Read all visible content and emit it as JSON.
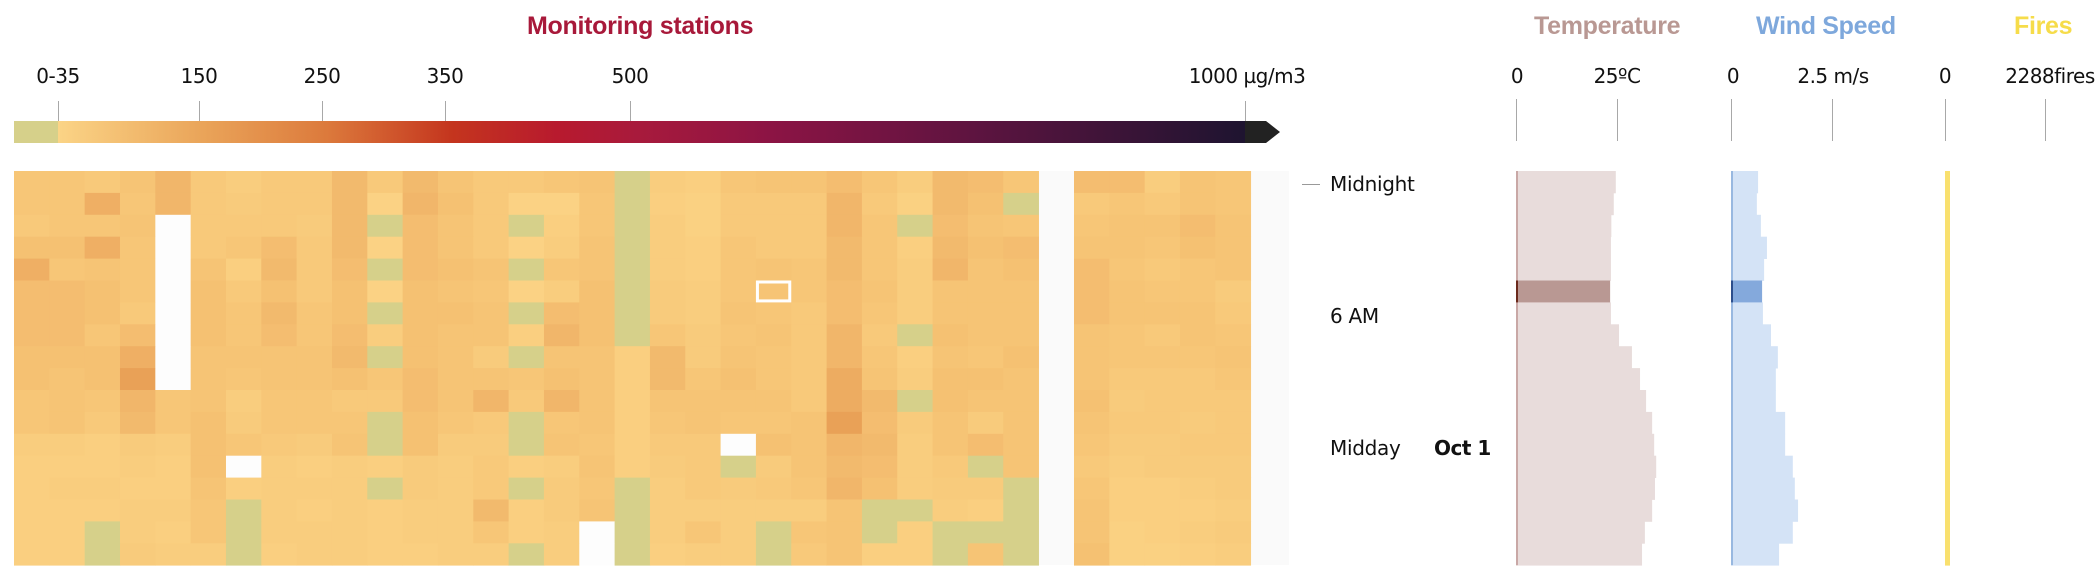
{
  "chart_data": {
    "type": "heatmap",
    "title": "Monitoring stations",
    "colorbar": {
      "unit": "µg/m3",
      "tick_labels": [
        "0-35",
        "150",
        "250",
        "350",
        "500",
        "1000 µg/m3"
      ],
      "tick_values": [
        35,
        150,
        250,
        350,
        500,
        1000
      ],
      "range": [
        0,
        1000
      ],
      "stops": [
        {
          "value": 0,
          "color": "#d6d08a"
        },
        {
          "value": 35,
          "color": "#d6d08a"
        },
        {
          "value": 35.01,
          "color": "#fbd486"
        },
        {
          "value": 150,
          "color": "#eaa55a"
        },
        {
          "value": 250,
          "color": "#dc7a3c"
        },
        {
          "value": 350,
          "color": "#c4351e"
        },
        {
          "value": 430,
          "color": "#b81a2e"
        },
        {
          "value": 500,
          "color": "#a81a3c"
        },
        {
          "value": 600,
          "color": "#8c1444"
        },
        {
          "value": 750,
          "color": "#5e1440"
        },
        {
          "value": 1000,
          "color": "#1e1430"
        },
        {
          "value": 1001,
          "color": "#222222"
        }
      ]
    },
    "y_labels": [
      {
        "label": "Midnight",
        "row": 0
      },
      {
        "label": "6 AM",
        "row": 6
      },
      {
        "label": "Midday",
        "row": 12
      }
    ],
    "date_label": {
      "label": "Oct 1",
      "row": 12
    },
    "hours": 18,
    "highlight": {
      "panel": 0,
      "row": 5,
      "col": 21
    },
    "panels": [
      {
        "name": "main",
        "columns": 29,
        "values": [
          [
            75,
            75,
            70,
            80,
            100,
            70,
            60,
            70,
            70,
            95,
            70,
            95,
            80,
            70,
            70,
            75,
            80,
            30,
            60,
            55,
            75,
            80,
            80,
            90,
            75,
            60,
            95,
            90,
            75
          ],
          [
            75,
            75,
            110,
            75,
            100,
            70,
            65,
            70,
            70,
            95,
            45,
            100,
            85,
            70,
            45,
            45,
            75,
            30,
            55,
            50,
            70,
            70,
            70,
            100,
            70,
            50,
            95,
            85,
            30
          ],
          [
            70,
            75,
            75,
            80,
            null,
            70,
            70,
            70,
            65,
            95,
            30,
            90,
            80,
            70,
            30,
            55,
            75,
            30,
            60,
            50,
            70,
            70,
            70,
            100,
            75,
            30,
            90,
            80,
            75
          ],
          [
            85,
            85,
            110,
            75,
            null,
            70,
            75,
            90,
            70,
            95,
            45,
            90,
            80,
            70,
            45,
            60,
            80,
            30,
            60,
            55,
            75,
            70,
            70,
            95,
            75,
            55,
            95,
            85,
            90
          ],
          [
            110,
            75,
            80,
            75,
            null,
            80,
            55,
            95,
            70,
            90,
            30,
            90,
            85,
            80,
            30,
            75,
            80,
            30,
            60,
            55,
            75,
            80,
            75,
            95,
            75,
            60,
            100,
            80,
            85
          ],
          [
            90,
            90,
            85,
            75,
            null,
            85,
            70,
            85,
            70,
            85,
            45,
            85,
            80,
            75,
            45,
            60,
            85,
            30,
            65,
            60,
            75,
            80,
            75,
            90,
            80,
            60,
            80,
            80,
            80
          ],
          [
            90,
            90,
            85,
            70,
            null,
            85,
            75,
            95,
            75,
            85,
            30,
            85,
            85,
            80,
            30,
            90,
            85,
            30,
            65,
            60,
            80,
            75,
            70,
            90,
            75,
            60,
            80,
            80,
            80
          ],
          [
            90,
            90,
            75,
            90,
            null,
            85,
            75,
            90,
            75,
            90,
            60,
            85,
            80,
            80,
            55,
            100,
            85,
            30,
            75,
            65,
            75,
            80,
            70,
            100,
            70,
            30,
            85,
            80,
            80
          ],
          [
            85,
            85,
            85,
            110,
            null,
            80,
            80,
            80,
            80,
            95,
            30,
            85,
            80,
            65,
            30,
            80,
            80,
            55,
            95,
            65,
            80,
            75,
            70,
            100,
            75,
            55,
            80,
            75,
            85
          ],
          [
            85,
            80,
            85,
            130,
            null,
            80,
            75,
            80,
            80,
            85,
            75,
            90,
            80,
            80,
            75,
            85,
            80,
            55,
            95,
            75,
            85,
            75,
            70,
            115,
            80,
            60,
            85,
            85,
            80
          ],
          [
            75,
            80,
            75,
            100,
            75,
            80,
            60,
            75,
            75,
            70,
            70,
            90,
            80,
            100,
            70,
            100,
            80,
            55,
            80,
            80,
            80,
            80,
            70,
            115,
            95,
            30,
            85,
            80,
            80
          ],
          [
            75,
            80,
            70,
            95,
            75,
            85,
            65,
            75,
            75,
            75,
            30,
            85,
            75,
            70,
            30,
            75,
            80,
            55,
            75,
            80,
            75,
            75,
            80,
            130,
            90,
            65,
            80,
            65,
            80
          ],
          [
            60,
            60,
            55,
            65,
            60,
            85,
            75,
            70,
            65,
            80,
            30,
            85,
            65,
            65,
            30,
            80,
            75,
            55,
            70,
            70,
            null,
            85,
            80,
            100,
            95,
            60,
            80,
            90,
            80
          ],
          [
            55,
            55,
            55,
            60,
            55,
            85,
            null,
            60,
            55,
            60,
            55,
            65,
            60,
            70,
            55,
            60,
            80,
            55,
            65,
            70,
            30,
            65,
            80,
            95,
            90,
            60,
            70,
            30,
            80
          ],
          [
            55,
            60,
            60,
            55,
            55,
            80,
            55,
            60,
            60,
            60,
            30,
            65,
            60,
            70,
            30,
            65,
            75,
            30,
            60,
            70,
            65,
            70,
            75,
            100,
            85,
            60,
            65,
            65,
            30
          ],
          [
            55,
            55,
            55,
            60,
            60,
            75,
            30,
            60,
            55,
            60,
            55,
            60,
            60,
            95,
            55,
            65,
            80,
            30,
            60,
            60,
            60,
            60,
            60,
            80,
            30,
            30,
            60,
            55,
            30
          ],
          [
            55,
            55,
            30,
            60,
            55,
            75,
            30,
            60,
            60,
            60,
            55,
            60,
            60,
            75,
            55,
            60,
            null,
            30,
            60,
            75,
            60,
            30,
            75,
            80,
            30,
            55,
            30,
            30,
            30
          ],
          [
            55,
            55,
            30,
            65,
            60,
            60,
            30,
            55,
            60,
            60,
            55,
            55,
            60,
            60,
            30,
            60,
            null,
            30,
            55,
            60,
            60,
            30,
            70,
            80,
            55,
            55,
            30,
            80,
            30
          ]
        ]
      },
      {
        "name": "secondary",
        "columns": 5,
        "values": [
          [
            90,
            90,
            60,
            80,
            75
          ],
          [
            70,
            75,
            70,
            80,
            75
          ],
          [
            75,
            80,
            80,
            90,
            80
          ],
          [
            80,
            80,
            75,
            85,
            80
          ],
          [
            90,
            75,
            70,
            75,
            80
          ],
          [
            90,
            80,
            75,
            75,
            65
          ],
          [
            90,
            80,
            80,
            80,
            70
          ],
          [
            80,
            75,
            70,
            80,
            75
          ],
          [
            80,
            75,
            75,
            75,
            80
          ],
          [
            80,
            70,
            70,
            70,
            75
          ],
          [
            85,
            65,
            70,
            70,
            70
          ],
          [
            80,
            70,
            70,
            65,
            70
          ],
          [
            75,
            65,
            65,
            70,
            70
          ],
          [
            70,
            60,
            65,
            65,
            65
          ],
          [
            75,
            55,
            55,
            60,
            65
          ],
          [
            80,
            55,
            55,
            55,
            60
          ],
          [
            80,
            50,
            55,
            60,
            65
          ],
          [
            85,
            50,
            50,
            55,
            60
          ]
        ]
      }
    ],
    "side_charts": [
      {
        "name": "Temperature",
        "color": "#b99893",
        "fill": "#e8dcdb",
        "highlight_fill": "#b99893",
        "axis_color": "#c9a8a6",
        "highlight_axis": "#6b2a1c",
        "tick_labels": [
          "0",
          "25ºC"
        ],
        "tick_values": [
          0,
          25
        ],
        "unit": "°C",
        "values": [
          24.7,
          24.2,
          23.6,
          23.5,
          23.5,
          23.3,
          23.5,
          25.5,
          28.7,
          30.7,
          32.2,
          33.7,
          34.2,
          34.7,
          34.4,
          33.7,
          31.9,
          31.2
        ]
      },
      {
        "name": "Wind Speed",
        "color": "#7ea8dc",
        "fill": "#d4e3f6",
        "highlight_fill": "#84a9dc",
        "axis_color": "#98b8e0",
        "highlight_axis": "#2c4e8c",
        "tick_labels": [
          "0",
          "2.5 m/s"
        ],
        "tick_values": [
          0,
          2.5
        ],
        "unit": "m/s",
        "values": [
          0.67,
          0.64,
          0.74,
          0.89,
          0.82,
          0.77,
          0.79,
          0.99,
          1.16,
          1.11,
          1.11,
          1.34,
          1.34,
          1.53,
          1.58,
          1.66,
          1.53,
          1.19
        ]
      },
      {
        "name": "Fires",
        "color": "#f6dc4a",
        "fill": "#f9e06e",
        "highlight_fill": "#f9e06e",
        "axis_color": "#f9e06e",
        "highlight_axis": "#f9e06e",
        "tick_labels": [
          "0",
          "2288fires"
        ],
        "tick_values": [
          0,
          2288
        ],
        "unit": "fires",
        "values": [
          110,
          110,
          110,
          110,
          110,
          110,
          110,
          110,
          110,
          110,
          110,
          110,
          110,
          110,
          110,
          110,
          110,
          110
        ]
      }
    ],
    "title_color": "#a8193a"
  }
}
